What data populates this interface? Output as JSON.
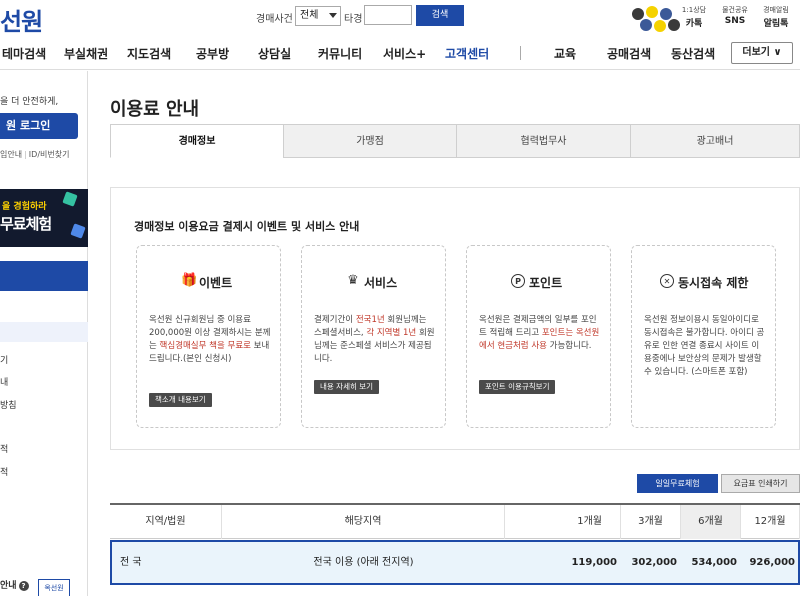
{
  "header": {
    "logo_text": "선원",
    "search_category_label": "경매사건",
    "search_select_value": "전체",
    "search_target_label": "타경",
    "search_input_value": "",
    "search_button_label": "검색",
    "social": [
      {
        "top": "1:1상담",
        "bottom": "카톡"
      },
      {
        "top": "물건공유",
        "bottom": "SNS"
      },
      {
        "top": "경매알림",
        "bottom": "알림톡"
      }
    ]
  },
  "gnb": {
    "items": [
      "테마검색",
      "부실채권",
      "지도검색",
      "공부방",
      "상담실",
      "커뮤니티",
      "서비스+",
      "고객센터",
      "교육",
      "공매검색",
      "동산검색"
    ],
    "active_index": 7,
    "more_label": "더보기 ∨"
  },
  "sidebar": {
    "safe_text": "을 더 안전하게,",
    "login_label": "원 로그인",
    "links": [
      "입안내",
      "ID/비번찾기"
    ],
    "banner_line1": "을 경험하라",
    "banner_line2": "무료체험",
    "items": [
      "기",
      "내",
      "방침",
      "적",
      "적"
    ],
    "bottom_label": "안내",
    "badge_text": "옥선원"
  },
  "main": {
    "title": "이용료 안내",
    "tabs": [
      "경매정보",
      "가맹점",
      "협력법무사",
      "광고배너"
    ],
    "active_tab": 0,
    "info_heading": "경매정보 이용요금 결제시 이벤트 및 서비스 안내",
    "cards": [
      {
        "icon": "gift-icon",
        "title": "이벤트",
        "body": [
          {
            "t": "옥선원 신규회원님 중 이용료 200,000원 이상 결제하시는 분께는 ",
            "h": false
          },
          {
            "t": "핵심경매실무 책을 무료로",
            "h": true
          },
          {
            "t": " 보내드립니다.(본인 신청시)",
            "h": false
          }
        ],
        "button": "책소개 내용보기"
      },
      {
        "icon": "crown-icon",
        "title": "서비스",
        "body": [
          {
            "t": "결제기간이 ",
            "h": false
          },
          {
            "t": "전국1년",
            "h": true
          },
          {
            "t": " 회원님께는 스페셜서비스, ",
            "h": false
          },
          {
            "t": "각 지역별 1년",
            "h": true
          },
          {
            "t": " 회원님께는 준스페셜 서비스가 제공됩니다.",
            "h": false
          }
        ],
        "button": "내용 자세히 보기"
      },
      {
        "icon": "point-icon",
        "title": "포인트",
        "body": [
          {
            "t": "옥선원은 결제금액의 일부를 포인트 적립해 드리고 ",
            "h": false
          },
          {
            "t": "포인트는 옥선원에서 현금처럼 사용",
            "h": true
          },
          {
            "t": " 가능합니다.",
            "h": false
          }
        ],
        "button": "포인트 이용규칙보기"
      },
      {
        "icon": "close-circle-icon",
        "title": "동시접속 제한",
        "body": [
          {
            "t": "옥선원 정보이용시 동일아이디로 동시접속은 불가합니다. 아이디 공유로 인한 연결 종료시 사이트 이용중에나 보안상의 문제가 발생할 수 있습니다. (스마트폰 포함)",
            "h": false
          }
        ],
        "button": ""
      }
    ],
    "free_trial_label": "일일무료체험",
    "print_label": "요금표 인쇄하기",
    "table": {
      "headers": [
        "지역/법원",
        "해당지역",
        "1개월",
        "3개월",
        "6개월",
        "12개월"
      ],
      "rows": [
        {
          "region": "전 국",
          "area": "전국 이용 (아래 전지역)",
          "m1": "119,000",
          "m3": "302,000",
          "m6": "534,000",
          "m12": "926,000"
        }
      ]
    }
  }
}
